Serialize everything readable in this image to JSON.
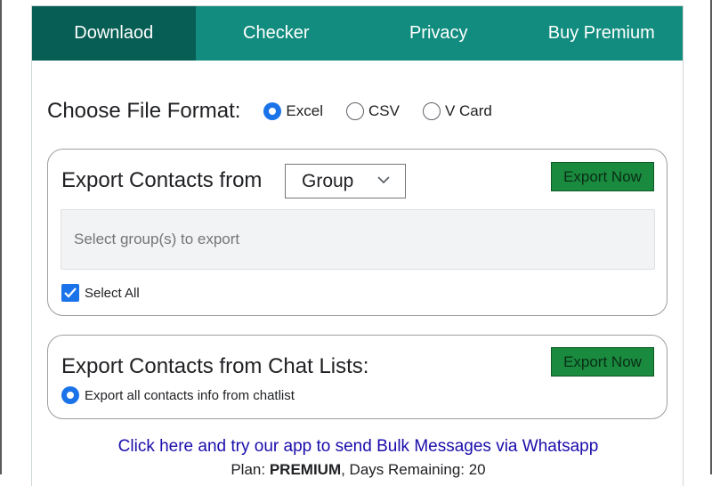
{
  "tabs": [
    {
      "label": "Downlaod",
      "active": true
    },
    {
      "label": "Checker",
      "active": false
    },
    {
      "label": "Privacy",
      "active": false
    },
    {
      "label": "Buy Premium",
      "active": false
    }
  ],
  "file_format": {
    "label": "Choose File Format:",
    "options": [
      {
        "label": "Excel",
        "selected": true
      },
      {
        "label": "CSV",
        "selected": false
      },
      {
        "label": "V Card",
        "selected": false
      }
    ]
  },
  "group_export": {
    "title": "Export Contacts from",
    "select_value": "Group",
    "button_label": "Export Now",
    "input_placeholder": "Select group(s) to export",
    "select_all_label": "Select All",
    "select_all_checked": true
  },
  "chat_export": {
    "title": "Export Contacts from Chat Lists:",
    "button_label": "Export Now",
    "option_label": "Export all contacts info from chatlist",
    "option_selected": true
  },
  "footer": {
    "promo_link": "Click here and try our app to send Bulk Messages via Whatsapp",
    "plan_prefix": "Plan: ",
    "plan_name": "PREMIUM",
    "days_text": ", Days Remaining: 20"
  },
  "colors": {
    "tab_bar": "#128c7e",
    "tab_active": "#075e54",
    "export_button": "#198a3e",
    "radio_selected": "#1a73e8",
    "link": "#1a0dab"
  },
  "icons": {
    "select_chevron": "chevron-down-icon",
    "select_all_check": "checkmark-icon"
  }
}
